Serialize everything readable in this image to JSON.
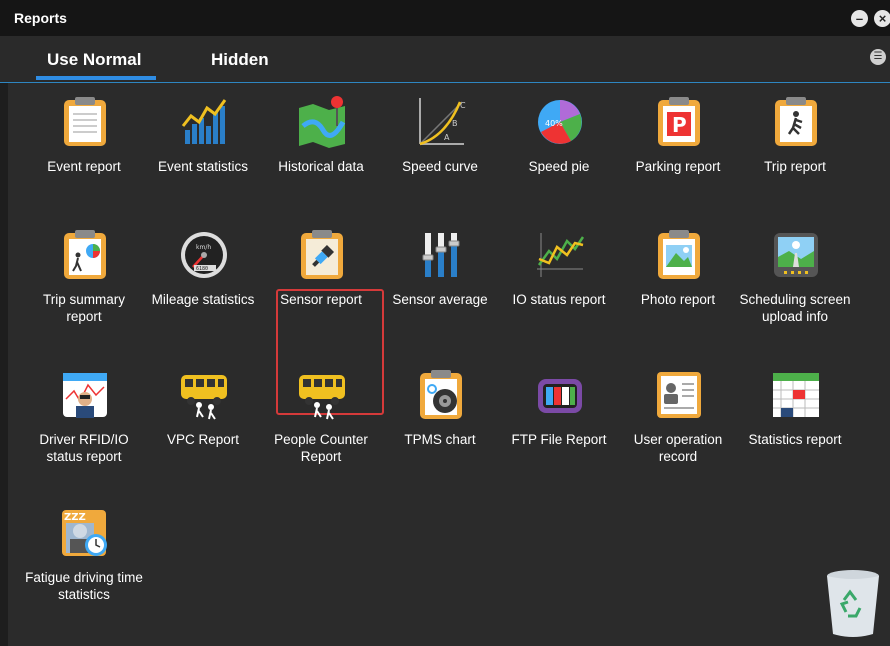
{
  "window": {
    "title": "Reports"
  },
  "tabs": [
    {
      "label": "Use Normal",
      "active": true
    },
    {
      "label": "Hidden",
      "active": false
    }
  ],
  "icons": {
    "minimize": "minimize-icon",
    "close": "close-icon",
    "menu": "list-menu-icon",
    "trash": "recycle-bin-icon"
  },
  "accent_color": "#2f8de4",
  "selected_outline_color": "#d53a3a",
  "reports": [
    {
      "label": "Event report",
      "icon": "clipboard-icon"
    },
    {
      "label": "Event statistics",
      "icon": "bar-line-chart-icon"
    },
    {
      "label": "Historical data",
      "icon": "map-pin-icon"
    },
    {
      "label": "Speed curve",
      "icon": "curve-chart-icon"
    },
    {
      "label": "Speed pie",
      "icon": "pie-chart-icon"
    },
    {
      "label": "Parking report",
      "icon": "parking-clipboard-icon"
    },
    {
      "label": "Trip report",
      "icon": "walking-clipboard-icon"
    },
    {
      "label": "Trip summary report",
      "icon": "trip-summary-clipboard-icon"
    },
    {
      "label": "Mileage statistics",
      "icon": "speedometer-icon"
    },
    {
      "label": "Sensor report",
      "icon": "sensor-clipboard-icon",
      "selected": true
    },
    {
      "label": "Sensor average",
      "icon": "sliders-icon"
    },
    {
      "label": "IO status report",
      "icon": "line-chart-icon"
    },
    {
      "label": "Photo report",
      "icon": "photo-clipboard-icon"
    },
    {
      "label": "Scheduling screen upload info",
      "icon": "screen-upload-icon"
    },
    {
      "label": "Driver RFID/IO status report",
      "icon": "driver-chart-icon"
    },
    {
      "label": "VPC Report",
      "icon": "bus-people-icon"
    },
    {
      "label": "People Counter Report",
      "icon": "bus-counter-icon"
    },
    {
      "label": "TPMS chart",
      "icon": "tire-clipboard-icon"
    },
    {
      "label": "FTP File Report",
      "icon": "tv-icon"
    },
    {
      "label": "User operation record",
      "icon": "user-card-icon"
    },
    {
      "label": "Statistics report",
      "icon": "spreadsheet-icon"
    },
    {
      "label": "Fatigue driving time statistics",
      "icon": "sleep-clock-icon"
    }
  ],
  "icon_texts": {
    "speed_pie_pct": "40%",
    "speed_curve_a": "A",
    "speed_curve_b": "B",
    "speed_curve_c": "C",
    "mileage_unit": "km/h",
    "mileage_odo": "6180",
    "parking_letter": "P",
    "fatigue_z": "ZZZ"
  }
}
